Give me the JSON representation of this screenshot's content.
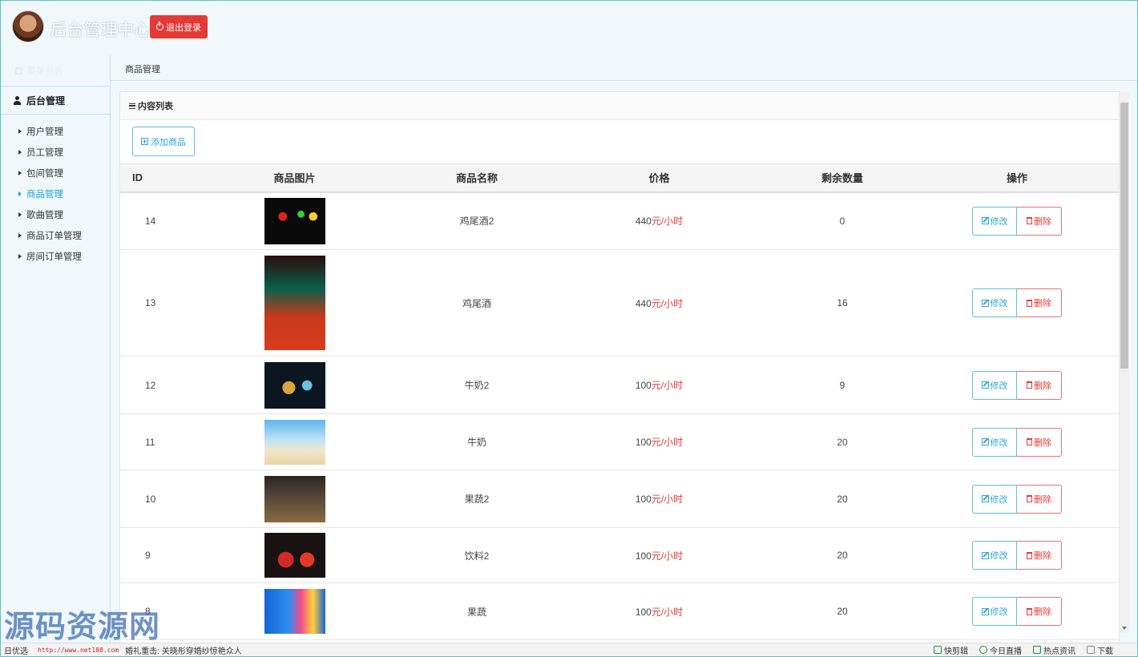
{
  "header": {
    "title": "后台管理中心",
    "logout_label": "退出登录"
  },
  "sidebar": {
    "top_label": "菜单列表",
    "section_label": "后台管理",
    "items": [
      "用户管理",
      "员工管理",
      "包间管理",
      "商品管理",
      "歌曲管理",
      "商品订单管理",
      "房间订单管理"
    ],
    "active_item": "商品管理"
  },
  "breadcrumb": "商品管理",
  "panel": {
    "title": "内容列表",
    "add_label": "添加商品"
  },
  "table": {
    "headers": [
      "ID",
      "商品图片",
      "商品名称",
      "价格",
      "剩余数量",
      "操作"
    ],
    "edit_label": "修改",
    "delete_label": "删除",
    "price_unit": "元/小时",
    "rows": [
      {
        "id": "14",
        "name": "鸡尾酒2",
        "price": "440",
        "stock": "0"
      },
      {
        "id": "13",
        "name": "鸡尾酒",
        "price": "440",
        "stock": "16"
      },
      {
        "id": "12",
        "name": "牛奶2",
        "price": "100",
        "stock": "9"
      },
      {
        "id": "11",
        "name": "牛奶",
        "price": "100",
        "stock": "20"
      },
      {
        "id": "10",
        "name": "果蔬2",
        "price": "100",
        "stock": "20"
      },
      {
        "id": "9",
        "name": "饮料2",
        "price": "100",
        "stock": "20"
      },
      {
        "id": "8",
        "name": "果蔬",
        "price": "100",
        "stock": "20"
      }
    ]
  },
  "watermark": "源码资源网",
  "statusbar": {
    "left": "日优选",
    "url": "http://www.net188.com",
    "news": "婚礼重击: 关晓彤穿婚纱惊艳众人",
    "items": [
      "快剪辑",
      "今日直播",
      "热点资讯",
      "下载"
    ]
  },
  "colors": {
    "accent": "#31a7d3",
    "danger": "#e53935",
    "background": "#f0f8fc"
  }
}
